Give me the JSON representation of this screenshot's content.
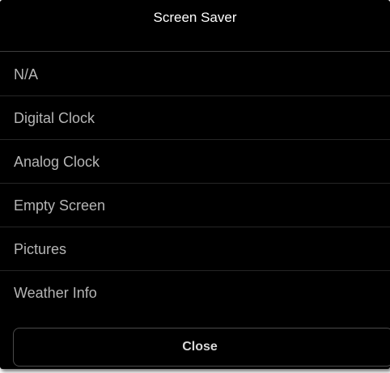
{
  "dialog": {
    "title": "Screen Saver",
    "options": [
      {
        "label": "N/A"
      },
      {
        "label": "Digital Clock"
      },
      {
        "label": "Analog Clock"
      },
      {
        "label": "Empty Screen"
      },
      {
        "label": "Pictures"
      },
      {
        "label": "Weather Info"
      }
    ],
    "close_label": "Close"
  },
  "colors": {
    "background": "#000000",
    "title_text": "#ffffff",
    "option_text": "#b5b5b5",
    "divider": "#262626",
    "button_border": "#4a4a4a"
  }
}
